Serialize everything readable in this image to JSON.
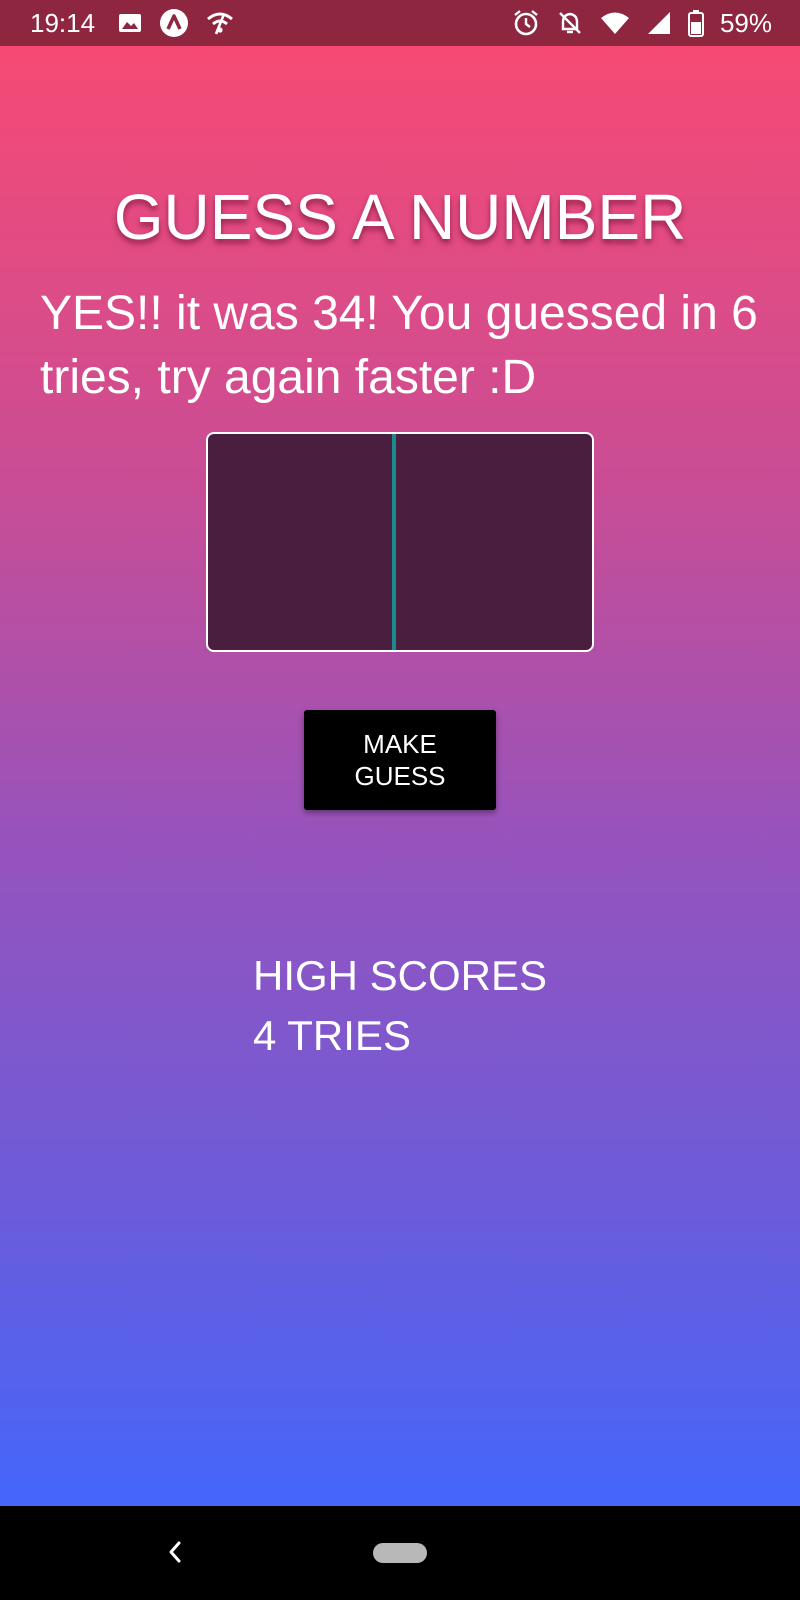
{
  "status_bar": {
    "time": "19:14",
    "battery": "59%",
    "icons": [
      "image-icon",
      "arc-app-icon",
      "wifi-off-icon",
      "alarm-icon",
      "notifications-off-icon",
      "wifi-icon",
      "signal-icon",
      "battery-icon"
    ]
  },
  "app": {
    "title": "GUESS A NUMBER",
    "message": "YES!! it was 34! You guessed in 6 tries, try again faster :D",
    "input_value": "",
    "guess_button_label": "MAKE GUESS",
    "high_scores_heading": "HIGH SCORES",
    "high_scores": [
      "4 TRIES"
    ]
  },
  "colors": {
    "gradient_top": "#f64a74",
    "gradient_bottom": "#4466fb",
    "input_bg": "#4a1e3f",
    "caret": "#1a8a8a",
    "button_bg": "#000000"
  },
  "nav_bar": {
    "icons": [
      "back-icon",
      "home-pill-icon"
    ]
  }
}
